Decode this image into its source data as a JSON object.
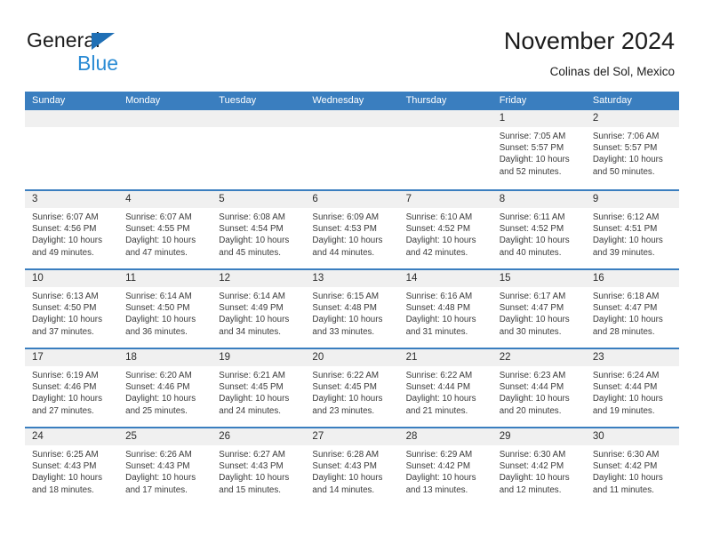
{
  "brand": {
    "name_part1": "General",
    "name_part2": "Blue",
    "triangle_color": "#1f6fb5",
    "blue_text_color": "#2a8bd4"
  },
  "header": {
    "title": "November 2024",
    "subtitle": "Colinas del Sol, Mexico"
  },
  "theme": {
    "header_blue": "#3a7ebf",
    "daynum_band": "#f0f0f0",
    "text": "#3a3a3a"
  },
  "weekday_headers": [
    "Sunday",
    "Monday",
    "Tuesday",
    "Wednesday",
    "Thursday",
    "Friday",
    "Saturday"
  ],
  "weeks": [
    [
      {
        "day": "",
        "lines": []
      },
      {
        "day": "",
        "lines": []
      },
      {
        "day": "",
        "lines": []
      },
      {
        "day": "",
        "lines": []
      },
      {
        "day": "",
        "lines": []
      },
      {
        "day": "1",
        "lines": [
          "Sunrise: 7:05 AM",
          "Sunset: 5:57 PM",
          "Daylight: 10 hours",
          "and 52 minutes."
        ]
      },
      {
        "day": "2",
        "lines": [
          "Sunrise: 7:06 AM",
          "Sunset: 5:57 PM",
          "Daylight: 10 hours",
          "and 50 minutes."
        ]
      }
    ],
    [
      {
        "day": "3",
        "lines": [
          "Sunrise: 6:07 AM",
          "Sunset: 4:56 PM",
          "Daylight: 10 hours",
          "and 49 minutes."
        ]
      },
      {
        "day": "4",
        "lines": [
          "Sunrise: 6:07 AM",
          "Sunset: 4:55 PM",
          "Daylight: 10 hours",
          "and 47 minutes."
        ]
      },
      {
        "day": "5",
        "lines": [
          "Sunrise: 6:08 AM",
          "Sunset: 4:54 PM",
          "Daylight: 10 hours",
          "and 45 minutes."
        ]
      },
      {
        "day": "6",
        "lines": [
          "Sunrise: 6:09 AM",
          "Sunset: 4:53 PM",
          "Daylight: 10 hours",
          "and 44 minutes."
        ]
      },
      {
        "day": "7",
        "lines": [
          "Sunrise: 6:10 AM",
          "Sunset: 4:52 PM",
          "Daylight: 10 hours",
          "and 42 minutes."
        ]
      },
      {
        "day": "8",
        "lines": [
          "Sunrise: 6:11 AM",
          "Sunset: 4:52 PM",
          "Daylight: 10 hours",
          "and 40 minutes."
        ]
      },
      {
        "day": "9",
        "lines": [
          "Sunrise: 6:12 AM",
          "Sunset: 4:51 PM",
          "Daylight: 10 hours",
          "and 39 minutes."
        ]
      }
    ],
    [
      {
        "day": "10",
        "lines": [
          "Sunrise: 6:13 AM",
          "Sunset: 4:50 PM",
          "Daylight: 10 hours",
          "and 37 minutes."
        ]
      },
      {
        "day": "11",
        "lines": [
          "Sunrise: 6:14 AM",
          "Sunset: 4:50 PM",
          "Daylight: 10 hours",
          "and 36 minutes."
        ]
      },
      {
        "day": "12",
        "lines": [
          "Sunrise: 6:14 AM",
          "Sunset: 4:49 PM",
          "Daylight: 10 hours",
          "and 34 minutes."
        ]
      },
      {
        "day": "13",
        "lines": [
          "Sunrise: 6:15 AM",
          "Sunset: 4:48 PM",
          "Daylight: 10 hours",
          "and 33 minutes."
        ]
      },
      {
        "day": "14",
        "lines": [
          "Sunrise: 6:16 AM",
          "Sunset: 4:48 PM",
          "Daylight: 10 hours",
          "and 31 minutes."
        ]
      },
      {
        "day": "15",
        "lines": [
          "Sunrise: 6:17 AM",
          "Sunset: 4:47 PM",
          "Daylight: 10 hours",
          "and 30 minutes."
        ]
      },
      {
        "day": "16",
        "lines": [
          "Sunrise: 6:18 AM",
          "Sunset: 4:47 PM",
          "Daylight: 10 hours",
          "and 28 minutes."
        ]
      }
    ],
    [
      {
        "day": "17",
        "lines": [
          "Sunrise: 6:19 AM",
          "Sunset: 4:46 PM",
          "Daylight: 10 hours",
          "and 27 minutes."
        ]
      },
      {
        "day": "18",
        "lines": [
          "Sunrise: 6:20 AM",
          "Sunset: 4:46 PM",
          "Daylight: 10 hours",
          "and 25 minutes."
        ]
      },
      {
        "day": "19",
        "lines": [
          "Sunrise: 6:21 AM",
          "Sunset: 4:45 PM",
          "Daylight: 10 hours",
          "and 24 minutes."
        ]
      },
      {
        "day": "20",
        "lines": [
          "Sunrise: 6:22 AM",
          "Sunset: 4:45 PM",
          "Daylight: 10 hours",
          "and 23 minutes."
        ]
      },
      {
        "day": "21",
        "lines": [
          "Sunrise: 6:22 AM",
          "Sunset: 4:44 PM",
          "Daylight: 10 hours",
          "and 21 minutes."
        ]
      },
      {
        "day": "22",
        "lines": [
          "Sunrise: 6:23 AM",
          "Sunset: 4:44 PM",
          "Daylight: 10 hours",
          "and 20 minutes."
        ]
      },
      {
        "day": "23",
        "lines": [
          "Sunrise: 6:24 AM",
          "Sunset: 4:44 PM",
          "Daylight: 10 hours",
          "and 19 minutes."
        ]
      }
    ],
    [
      {
        "day": "24",
        "lines": [
          "Sunrise: 6:25 AM",
          "Sunset: 4:43 PM",
          "Daylight: 10 hours",
          "and 18 minutes."
        ]
      },
      {
        "day": "25",
        "lines": [
          "Sunrise: 6:26 AM",
          "Sunset: 4:43 PM",
          "Daylight: 10 hours",
          "and 17 minutes."
        ]
      },
      {
        "day": "26",
        "lines": [
          "Sunrise: 6:27 AM",
          "Sunset: 4:43 PM",
          "Daylight: 10 hours",
          "and 15 minutes."
        ]
      },
      {
        "day": "27",
        "lines": [
          "Sunrise: 6:28 AM",
          "Sunset: 4:43 PM",
          "Daylight: 10 hours",
          "and 14 minutes."
        ]
      },
      {
        "day": "28",
        "lines": [
          "Sunrise: 6:29 AM",
          "Sunset: 4:42 PM",
          "Daylight: 10 hours",
          "and 13 minutes."
        ]
      },
      {
        "day": "29",
        "lines": [
          "Sunrise: 6:30 AM",
          "Sunset: 4:42 PM",
          "Daylight: 10 hours",
          "and 12 minutes."
        ]
      },
      {
        "day": "30",
        "lines": [
          "Sunrise: 6:30 AM",
          "Sunset: 4:42 PM",
          "Daylight: 10 hours",
          "and 11 minutes."
        ]
      }
    ]
  ]
}
